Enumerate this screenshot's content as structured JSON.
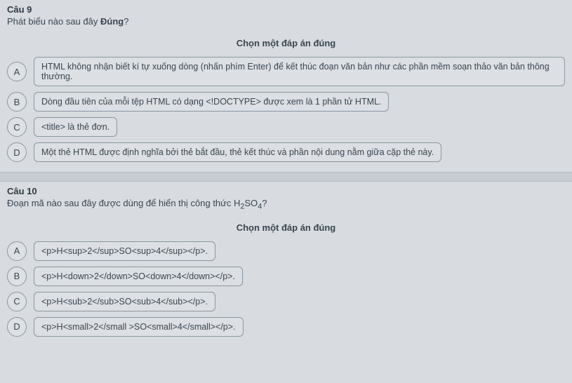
{
  "questions": [
    {
      "number": "Câu 9",
      "prompt_html": "Phát biểu nào sau đây <b>Đúng</b>?",
      "instruction": "Chọn một đáp án đúng",
      "options": [
        {
          "letter": "A",
          "text": "HTML không nhận biết kí tự xuống dòng (nhấn phím Enter) để kết thúc đoạn văn bản như các phần mềm soạn thảo văn bản thông thường."
        },
        {
          "letter": "B",
          "text": "Dòng đầu tiên của mỗi tệp HTML có dạng <!DOCTYPE> được xem là 1 phần tử HTML."
        },
        {
          "letter": "C",
          "text": "<title> là thẻ đơn."
        },
        {
          "letter": "D",
          "text": "Một thẻ HTML được định nghĩa bởi thẻ bắt đầu, thẻ kết thúc và phần nội dung nằm giữa cặp thẻ này."
        }
      ]
    },
    {
      "number": "Câu 10",
      "prompt_html": "Đoạn mã nào sau đây được dùng để hiển thị công thức H<sub>2</sub>SO<sub>4</sub>?",
      "instruction": "Chọn một đáp án đúng",
      "options": [
        {
          "letter": "A",
          "text": "<p>H<sup>2</sup>SO<sup>4</sup></p>."
        },
        {
          "letter": "B",
          "text": "<p>H<down>2</down>SO<down>4</down></p>."
        },
        {
          "letter": "C",
          "text": "<p>H<sub>2</sub>SO<sub>4</sub></p>."
        },
        {
          "letter": "D",
          "text": "<p>H<small>2</small >SO<small>4</small></p>."
        }
      ]
    }
  ]
}
